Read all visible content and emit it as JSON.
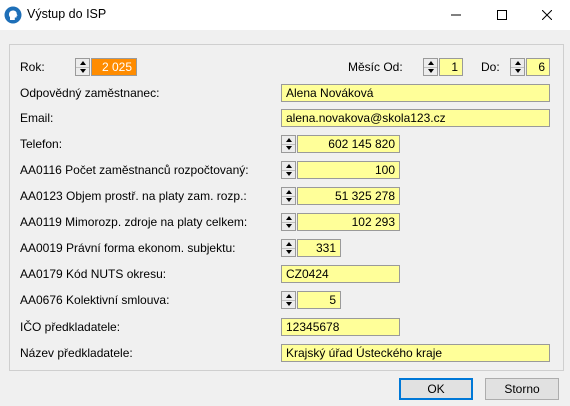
{
  "window": {
    "title": "Výstup do ISP",
    "controls": [
      "minimize",
      "maximize",
      "close"
    ],
    "icon": "head-silhouette-icon"
  },
  "header": {
    "rok_label": "Rok:",
    "rok_value": "2 025",
    "mesic_od_label": "Měsíc Od:",
    "mesic_od_value": "1",
    "do_label": "Do:",
    "do_value": "6"
  },
  "form": {
    "employee_label": "Odpovědný zaměstnanec:",
    "employee_value": "Alena Nováková",
    "email_label": "Email:",
    "email_value": "alena.novakova@skola123.cz",
    "phone_label": "Telefon:",
    "phone_value": "602 145 820",
    "aa0116_label": "AA0116 Počet zaměstnanců rozpočtovaný:",
    "aa0116_value": "100",
    "aa0123_label": "AA0123 Objem prostř. na platy zam.  rozp.:",
    "aa0123_value": "51 325 278",
    "aa0119_label": "AA0119 Mimorozp. zdroje na platy celkem:",
    "aa0119_value": "102 293",
    "aa0019_label": "AA0019 Právní forma ekonom. subjektu:",
    "aa0019_value": "331",
    "aa0179_label": "AA0179 Kód NUTS okresu:",
    "aa0179_value": "CZ0424",
    "aa0676_label": "AA0676 Kolektivní smlouva:",
    "aa0676_value": "5",
    "ico_label": "IČO předkladatele:",
    "ico_value": "12345678",
    "nazev_label": "Název předkladatele:",
    "nazev_value": "Krajský úřad Ústeckého kraje"
  },
  "buttons": {
    "ok": "OK",
    "cancel": "Storno"
  },
  "colors": {
    "field_bg": "#ffff99",
    "selection_bg": "#ff8c00",
    "default_button_border": "#0078d7"
  }
}
